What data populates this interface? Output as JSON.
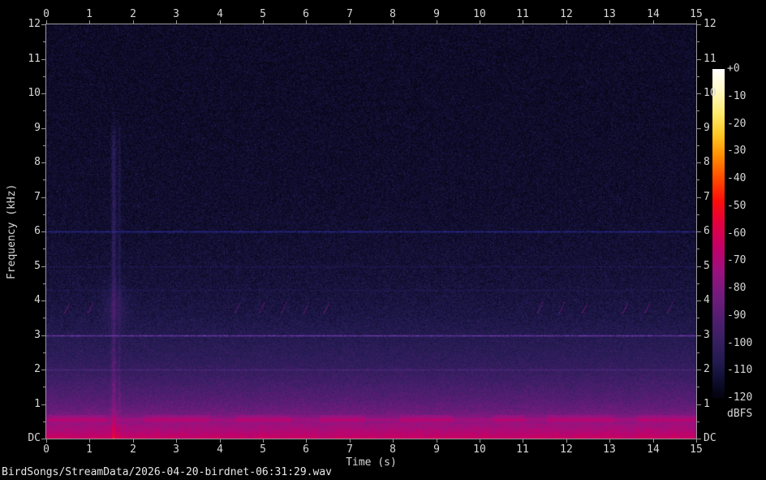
{
  "window": {
    "background": "#000000"
  },
  "status_bar": {
    "file_path": "BirdSongs/StreamData/2026-04-20-birdnet-06:31:29.wav"
  },
  "chart_data": {
    "type": "heatmap",
    "title": "",
    "xlabel": "Time (s)",
    "ylabel": "Frequency (kHz)",
    "x_range_s": [
      0,
      15
    ],
    "y_range_khz": [
      0,
      12
    ],
    "grid": false,
    "axes_color": "#9a9a9a",
    "text_color": "#d8d8d8",
    "x_tick_labels": [
      "0",
      "1",
      "2",
      "3",
      "4",
      "5",
      "6",
      "7",
      "8",
      "9",
      "10",
      "11",
      "12",
      "13",
      "14",
      "15"
    ],
    "y_tick_labels": [
      {
        "khz": 12,
        "label": "12"
      },
      {
        "khz": 11,
        "label": "11"
      },
      {
        "khz": 10,
        "label": "10"
      },
      {
        "khz": 9,
        "label": "9"
      },
      {
        "khz": 8,
        "label": "8"
      },
      {
        "khz": 7,
        "label": "7"
      },
      {
        "khz": 6,
        "label": "6"
      },
      {
        "khz": 5,
        "label": "5"
      },
      {
        "khz": 4,
        "label": "4"
      },
      {
        "khz": 3,
        "label": "3"
      },
      {
        "khz": 2,
        "label": "2"
      },
      {
        "khz": 1,
        "label": "1"
      },
      {
        "khz": 0,
        "label": "DC"
      }
    ],
    "y_minor_ticks_khz": [
      0.5,
      1.5,
      2.5,
      3.5,
      4.5,
      5.5,
      6.5,
      7.5,
      8.5,
      9.5,
      10.5,
      11.5
    ],
    "colorbar": {
      "label": "dBFS",
      "tick_labels": [
        "+0",
        "-10",
        "-20",
        "-30",
        "-40",
        "-50",
        "-60",
        "-70",
        "-80",
        "-90",
        "-100",
        "-110",
        "-120"
      ],
      "db_range": [
        0,
        -120
      ],
      "palette_stops_db_rgb": [
        [
          0,
          [
            255,
            255,
            255
          ]
        ],
        [
          -8,
          [
            255,
            249,
            195
          ]
        ],
        [
          -16,
          [
            255,
            236,
            110
          ]
        ],
        [
          -24,
          [
            255,
            200,
            35
          ]
        ],
        [
          -32,
          [
            255,
            140,
            0
          ]
        ],
        [
          -40,
          [
            255,
            75,
            0
          ]
        ],
        [
          -48,
          [
            252,
            15,
            10
          ]
        ],
        [
          -56,
          [
            230,
            0,
            62
          ]
        ],
        [
          -65,
          [
            196,
            0,
            105
          ]
        ],
        [
          -74,
          [
            155,
            18,
            128
          ]
        ],
        [
          -83,
          [
            113,
            28,
            126
          ]
        ],
        [
          -92,
          [
            80,
            30,
            113
          ]
        ],
        [
          -100,
          [
            54,
            30,
            97
          ]
        ],
        [
          -107,
          [
            34,
            27,
            80
          ]
        ],
        [
          -113,
          [
            18,
            15,
            52
          ]
        ],
        [
          -118,
          [
            7,
            6,
            24
          ]
        ],
        [
          -123,
          [
            1,
            1,
            4
          ]
        ]
      ]
    },
    "noise_floor_db_by_khz": [
      [
        12,
        -115.5
      ],
      [
        9,
        -115
      ],
      [
        7,
        -114.3
      ],
      [
        6,
        -113.6
      ],
      [
        5,
        -112.5
      ],
      [
        4.2,
        -111
      ],
      [
        3.6,
        -109.5
      ],
      [
        3.1,
        -107
      ],
      [
        2.8,
        -105.5
      ],
      [
        2.4,
        -103.5
      ],
      [
        2.0,
        -100.5
      ],
      [
        1.7,
        -97.5
      ],
      [
        1.4,
        -94
      ],
      [
        1.15,
        -91
      ],
      [
        1.0,
        -88.5
      ],
      [
        0.85,
        -86
      ],
      [
        0.7,
        -82.5
      ],
      [
        0.58,
        -79
      ],
      [
        0.48,
        -76
      ],
      [
        0.38,
        -73.5
      ],
      [
        0.28,
        -71
      ],
      [
        0.18,
        -68.5
      ],
      [
        0.08,
        -65.5
      ],
      [
        0,
        -63.5
      ]
    ],
    "tonal_lines": [
      {
        "khz": 6.0,
        "rgb": [
          45,
          45,
          160
        ],
        "alpha": 0.9
      },
      {
        "khz": 3.0,
        "rgb": [
          125,
          65,
          190
        ],
        "alpha": 0.85
      },
      {
        "khz": 5.0,
        "rgb": [
          40,
          38,
          120
        ],
        "alpha": 0.4
      },
      {
        "khz": 4.3,
        "rgb": [
          42,
          38,
          118
        ],
        "alpha": 0.35
      },
      {
        "khz": 2.0,
        "rgb": [
          110,
          55,
          160
        ],
        "alpha": 0.4
      }
    ],
    "bird_calls": {
      "khz_start": 3.68,
      "khz_end": 3.95,
      "duration_s": 0.13,
      "level_db": -79,
      "times_s": [
        0.42,
        0.95,
        4.35,
        4.9,
        5.42,
        5.93,
        6.4,
        11.33,
        11.84,
        12.36,
        13.3,
        13.8,
        14.33
      ]
    },
    "transient": {
      "time_s": 1.55,
      "width_s": 0.05,
      "boost_db": 11,
      "top_khz": 8.3,
      "echo_time_s": 1.68,
      "echo_width_s": 0.03,
      "echo_boost_db": 6,
      "blob_time_s": 1.6,
      "blob_khz": 3.85,
      "blob_boost_db": 6.5
    },
    "low_band_stripe": {
      "khz_center": 0.55,
      "khz_halfwidth": 0.07,
      "level_db": -72,
      "bright_level_db": -67,
      "bright_segments_s": [
        [
          0.05,
          1.4
        ],
        [
          2.25,
          3.75
        ],
        [
          4.35,
          5.65
        ],
        [
          6.3,
          7.35
        ],
        [
          8.15,
          9.4
        ],
        [
          10.3,
          11.05
        ],
        [
          11.55,
          13.1
        ],
        [
          13.65,
          15.0
        ]
      ]
    }
  }
}
